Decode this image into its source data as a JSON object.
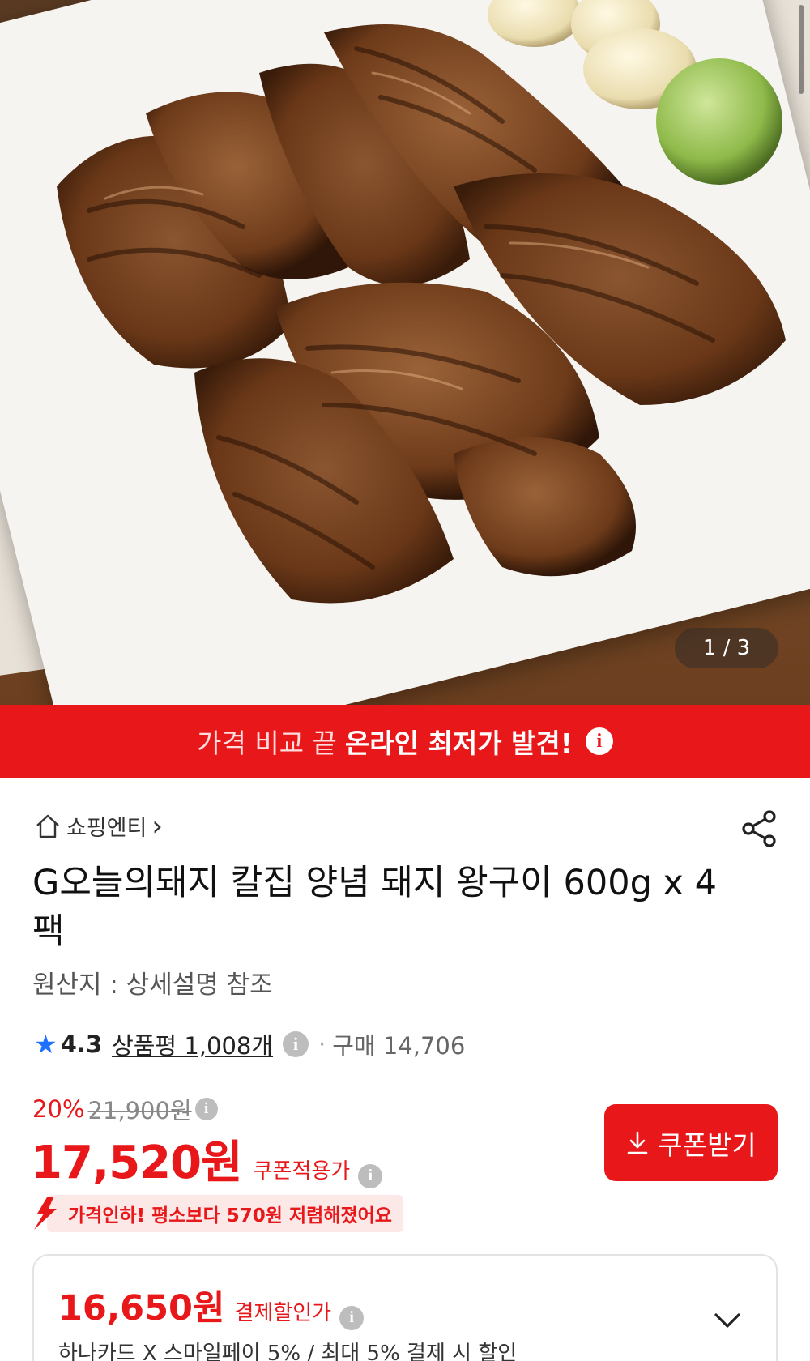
{
  "gallery": {
    "pager": "1 / 3"
  },
  "banner": {
    "pre": "가격 비교 끝",
    "strong": "온라인 최저가 발견!",
    "info": "i"
  },
  "store": {
    "name": "쇼핑엔티",
    "arrow": "›"
  },
  "product": {
    "title": "G오늘의돼지 칼집 양념 돼지 왕구이 600g x 4팩",
    "origin": "원산지 : 상세설명 참조"
  },
  "rating": {
    "score": "4.3",
    "reviews": "상품평 1,008개",
    "sep": "·",
    "purchase": "구매 14,706"
  },
  "price": {
    "discount_pct": "20%",
    "original": "21,900원",
    "coupon_price": "17,520원",
    "coupon_label": "쿠폰적용가",
    "coupon_button": "쿠폰받기",
    "drop_note": "가격인하! 평소보다 570원 저렴해졌어요"
  },
  "payment": {
    "price": "16,650원",
    "label": "결제할인가",
    "desc": "하나카드 X 스마일페이 5% / 최대 5% 결제 시 할인"
  },
  "colors": {
    "accent": "#e8171a",
    "star": "#1e70ff",
    "pill_bg": "#fde8e8"
  },
  "icons": [
    "home-icon",
    "share-icon",
    "info-icon",
    "star-icon",
    "download-icon",
    "price-drop-arrow-icon",
    "chevron-down-icon"
  ]
}
